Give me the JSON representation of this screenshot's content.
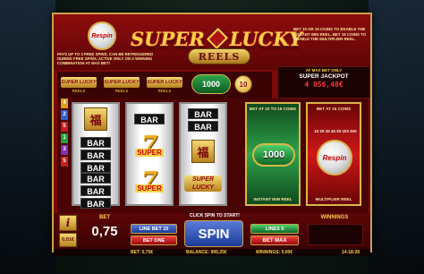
{
  "header": {
    "respin_badge": "Respin",
    "logo_word_1": "SUPER",
    "logo_word_2": "LUCKY",
    "logo_sub": "REELS",
    "rule_left": "PAYS UP TO 3 FREE SPINS. CAN BE RETRIGGERED DURING FREE SPINS. ACTIVE ONLY ON A WINNING COMBINATION AT MAX BET!",
    "rule_right": "BET 10 OR 15 COINS TO ENABLE THE INSTANT WIN REEL. BET 15 COINS TO ENABLE THE MULTIPLIER REEL."
  },
  "paytable": {
    "items": [
      {
        "logo": "SUPER LUCKY",
        "sub": "REELS"
      },
      {
        "logo": "SUPER LUCKY",
        "sub": "REELS"
      },
      {
        "logo": "SUPER LUCKY",
        "sub": "REELS"
      }
    ],
    "coin_value": "1000",
    "ten_badge": "10"
  },
  "jackpot": {
    "bet_note": "AT MAX BET ONLY",
    "title": "SUPER JACKPOT",
    "value": "4 056,48€"
  },
  "paylines": [
    "4",
    "2",
    "5",
    "1",
    "3",
    "5"
  ],
  "reels": {
    "reel1": {
      "top": "福",
      "bars": [
        "BAR",
        "BAR",
        "BAR"
      ],
      "bottom_bars": [
        "BAR",
        "BAR",
        "BAR"
      ]
    },
    "reel2": {
      "bar": "BAR",
      "seven_label_1": "SUPER",
      "seven_label_2": "SUPER"
    },
    "reel3": {
      "bars": [
        "BAR",
        "BAR"
      ],
      "fu": "福",
      "logo": "SUPER LUCKY"
    }
  },
  "bonus_green": {
    "head": "BET AT 10 TO 15 COINS",
    "coin": "1000",
    "foot": "INSTANT WIN REEL"
  },
  "bonus_red": {
    "head": "BET AT 15 COINS",
    "text": "1X 2X 3X 4X 5X 10X 20X",
    "badge": "Respin",
    "foot": "MULTIPLIER REEL"
  },
  "controls": {
    "info": "i",
    "coin_value": "0,01€",
    "bet_label": "BET",
    "bet_value": "0,75",
    "line_bet": "LINE BET 15",
    "bet_one": "BET ONE",
    "spin_hint": "CLICK SPIN TO START!",
    "spin": "SPIN",
    "lines": "LINES 5",
    "bet_max": "BET MAX",
    "winnings_label": "WINNINGS"
  },
  "status": {
    "bet": "BET: 0,75€",
    "balance": "BALANCE: 999,25€",
    "winnings": "WINNINGS: 0,00€",
    "time": "14:18:28"
  }
}
